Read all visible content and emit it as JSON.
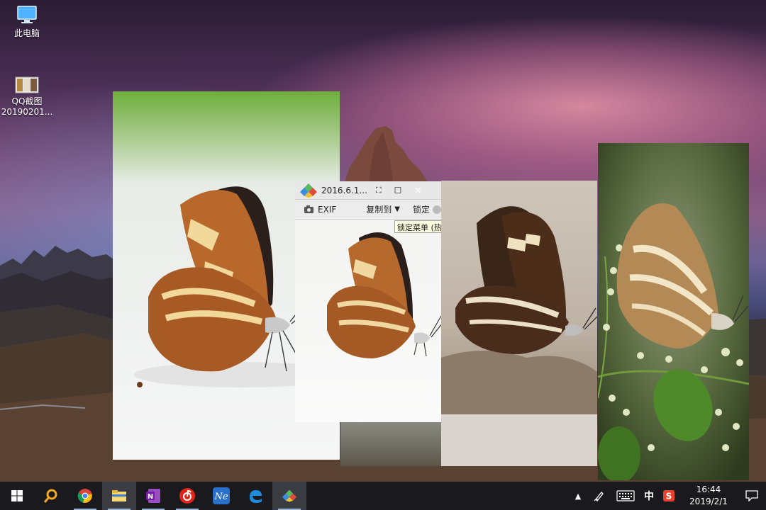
{
  "desktop": {
    "icons": [
      {
        "label": "此电脑",
        "icon": "computer-icon"
      },
      {
        "label": "QQ截图",
        "label2": "20190201...",
        "icon": "image-file-icon"
      }
    ]
  },
  "viewer": {
    "title": "2016.6.1...",
    "toolbar": {
      "exif_label": "EXIF",
      "copy_to_label": "复制到",
      "lock_label": "锁定"
    },
    "tooltip": "锁定菜单 (热"
  },
  "taskbar": {
    "apps": [
      {
        "name": "start",
        "icon": "windows-logo-icon"
      },
      {
        "name": "search",
        "icon": "search-icon"
      },
      {
        "name": "chrome",
        "icon": "chrome-icon"
      },
      {
        "name": "file-explorer",
        "icon": "folder-icon"
      },
      {
        "name": "onenote",
        "icon": "onenote-icon"
      },
      {
        "name": "netease-music",
        "icon": "music-icon"
      },
      {
        "name": "ne-app",
        "icon": "ne-app-icon",
        "text": "Ne"
      },
      {
        "name": "edge",
        "icon": "edge-icon"
      },
      {
        "name": "image-viewer",
        "icon": "diamond-viewer-icon"
      }
    ],
    "tray": {
      "ime_label": "中",
      "time": "16:44",
      "date": "2019/2/1"
    }
  },
  "colors": {
    "taskbar_bg": "#1a1a1e",
    "viewer_titlebar_bg": "#e8e8e8",
    "tooltip_bg": "#ffffe1"
  }
}
